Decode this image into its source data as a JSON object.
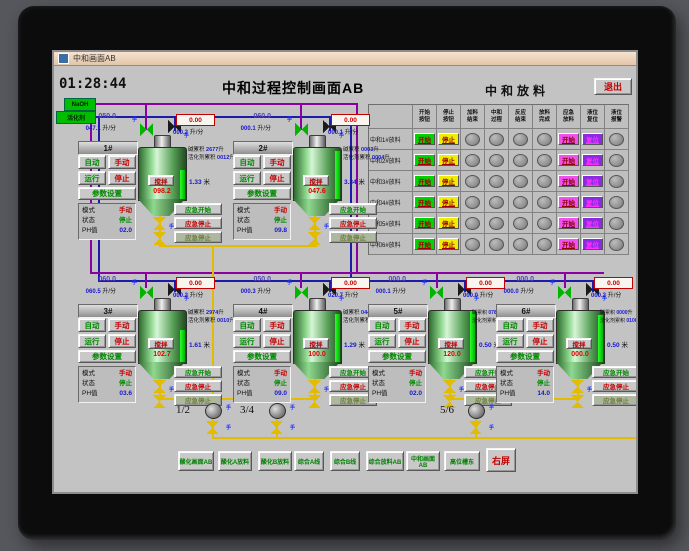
{
  "window": {
    "titlebar_title": "中和画面AB",
    "time": "01:28:44",
    "main_title": "中和过程控制画面AB",
    "exit_label": "退出"
  },
  "feeds": {
    "alkali": "NaOH",
    "activator": "活化剂"
  },
  "labels": {
    "auto": "自动",
    "manual": "手动",
    "run": "运行",
    "stop": "停止",
    "params": "参数设置",
    "mode": "模式",
    "state": "状态",
    "ph": "PH值",
    "stir": "搅拌",
    "alkali_total": "碱累积",
    "activator_total": "活化剂累积",
    "unit_volume": "升",
    "unit_flow": "升/分",
    "unit_level": "米",
    "emg_start": "应急开始",
    "emg_stop": "应急停止",
    "emg_stop_dim": "应急停止",
    "hand": "手"
  },
  "reactors": [
    {
      "id": "1#",
      "sp": "050.0",
      "pv": "047.1",
      "rsp": "0.00",
      "rpv": "000.2",
      "alkali": "2677",
      "activator": "0012",
      "level": "1.33",
      "stir_value": "098.2",
      "mode": "手动",
      "state": "停止",
      "ph": "02.0"
    },
    {
      "id": "2#",
      "sp": "060.0",
      "pv": "000.1",
      "rsp": "0.00",
      "rpv": "000.1",
      "alkali": "0003",
      "activator": "0004",
      "level": "3.34",
      "stir_value": "047.6",
      "mode": "手动",
      "state": "停止",
      "ph": "09.8"
    },
    {
      "id": "3#",
      "sp": "060.0",
      "pv": "060.5",
      "rsp": "0.00",
      "rpv": "000.2",
      "alkali": "2974",
      "activator": "0010",
      "level": "1.61",
      "stir_value": "102.7",
      "mode": "手动",
      "state": "停止",
      "ph": "03.6"
    },
    {
      "id": "4#",
      "sp": "050.0",
      "pv": "000.3",
      "rsp": "0.00",
      "rpv": "020.7",
      "alkali": "0447",
      "activator": "0104",
      "level": "1.29",
      "stir_value": "100.0",
      "mode": "手动",
      "state": "停止",
      "ph": "09.0"
    },
    {
      "id": "5#",
      "sp": "000.0",
      "pv": "000.1",
      "rsp": "0.00",
      "rpv": "000.0",
      "alkali": "0787",
      "activator": "0001",
      "level": "0.50",
      "stir_value": "120.0",
      "mode": "手动",
      "state": "停止",
      "ph": "02.0"
    },
    {
      "id": "6#",
      "sp": "000.0",
      "pv": "000.0",
      "rsp": "0.00",
      "rpv": "000.2",
      "alkali": "0000",
      "activator": "0106",
      "level": "0.50",
      "stir_value": "000.0",
      "mode": "手动",
      "state": "停止",
      "ph": "14.0"
    }
  ],
  "discharge": {
    "title": "中和放料",
    "columns": [
      "开始\n按钮",
      "停止\n按钮",
      "加料\n结束",
      "中和\n过程",
      "反应\n结束",
      "放料\n完成",
      "应急\n放料",
      "液位\n复位",
      "液位\n报警"
    ],
    "rows": [
      {
        "label": "中和1#放料",
        "start": "开始",
        "stop": "停止",
        "emg": "开始",
        "reset": "复位"
      },
      {
        "label": "中和2#放料",
        "start": "开始",
        "stop": "停止",
        "emg": "开始",
        "reset": "复位"
      },
      {
        "label": "中和3#放料",
        "start": "开始",
        "stop": "停止",
        "emg": "开始",
        "reset": "复位"
      },
      {
        "label": "中和4#放料",
        "start": "开始",
        "stop": "停止",
        "emg": "开始",
        "reset": "复位"
      },
      {
        "label": "中和5#放料",
        "start": "开始",
        "stop": "停止",
        "emg": "开始",
        "reset": "复位"
      },
      {
        "label": "中和6#放料",
        "start": "开始",
        "stop": "停止",
        "emg": "开始",
        "reset": "复位"
      }
    ]
  },
  "pumps": [
    {
      "label": "1/2"
    },
    {
      "label": "3/4"
    },
    {
      "label": "5/6"
    }
  ],
  "nav": {
    "items": [
      "酸化画面AB",
      "酸化A放料",
      "酸化B放料",
      "综合A线",
      "综合B线",
      "综合放料AB",
      "中和画面AB",
      "高位槽东"
    ],
    "right_screen": "右屏"
  }
}
